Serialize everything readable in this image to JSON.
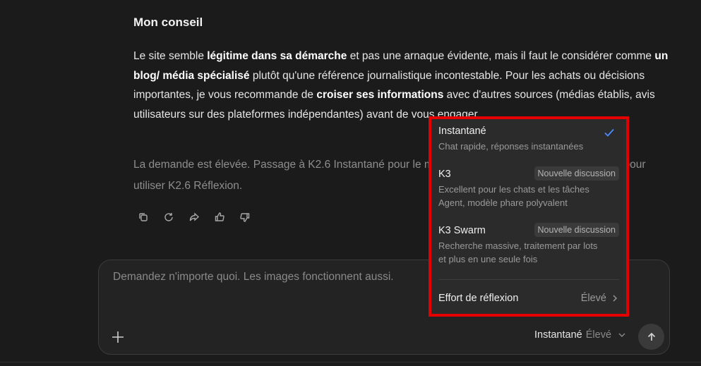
{
  "message": {
    "heading": "Mon conseil",
    "para": {
      "p1": "Le site semble ",
      "b1": "légitime dans sa démarche",
      "p2": " et pas une arnaque évidente, mais il faut le considérer comme ",
      "b2": "un blog/ média spécialisé",
      "p3": " plutôt qu'une référence journalistique incontestable. Pour les achats ou décisions importantes, je vous recommande de ",
      "b3": "croiser ses informations",
      "p4": " avec d'autres sources (médias établis, avis utilisateurs sur des plateformes indépendantes) avant de vous engager."
    },
    "note": "La demande est élevée. Passage à K2.6 Instantané pour le moment. Passez à la formule supérieure pour utiliser K2.6 Réflexion."
  },
  "actions": [
    {
      "icon": "copy-icon"
    },
    {
      "icon": "refresh-icon"
    },
    {
      "icon": "share-icon"
    },
    {
      "icon": "thumbs-up-icon"
    },
    {
      "icon": "thumbs-down-icon"
    }
  ],
  "composer": {
    "placeholder": "Demandez n'importe quoi. Les images fonctionnent aussi.",
    "mode_label": "Instantané",
    "effort_label": "Élevé"
  },
  "menu": {
    "options": [
      {
        "name": "Instantané",
        "desc_lines": [
          "Chat rapide, réponses instantanées"
        ],
        "selected": true
      },
      {
        "name": "K3",
        "badge": "Nouvelle discussion",
        "desc_lines": [
          "Excellent pour les chats et les tâches",
          "Agent, modèle phare polyvalent"
        ]
      },
      {
        "name": "K3 Swarm",
        "badge": "Nouvelle discussion",
        "desc_lines": [
          "Recherche massive, traitement par lots",
          "et plus en une seule fois"
        ]
      }
    ],
    "effort": {
      "label": "Effort de réflexion",
      "value": "Élevé"
    }
  },
  "colors": {
    "background": "#1b1b1b",
    "highlight_border": "#e50000",
    "check": "#4a8cff"
  }
}
